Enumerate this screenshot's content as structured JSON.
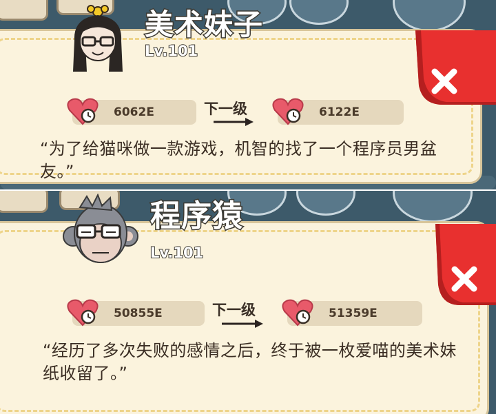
{
  "colors": {
    "panel": "#fbf3dd",
    "dash": "#eed48a",
    "pill": "#e5d8bd",
    "close_red": "#e8302f",
    "heart": "#e85a6a"
  },
  "cards": [
    {
      "name": "美术妹子",
      "level": "Lv.101",
      "current_value": "6062E",
      "next_label": "下一级",
      "next_value": "6122E",
      "description": "“为了给猫咪做一款游戏，机智的找了一个程序员男盆友。”",
      "heart_icon": "heart-clock-icon",
      "close_icon": "close-icon"
    },
    {
      "name": "程序猿",
      "level": "Lv.101",
      "current_value": "50855E",
      "next_label": "下一级",
      "next_value": "51359E",
      "description": "“经历了多次失败的感情之后，终于被一枚爱喵的美术妹纸收留了。”",
      "heart_icon": "heart-clock-icon",
      "close_icon": "close-icon"
    }
  ]
}
